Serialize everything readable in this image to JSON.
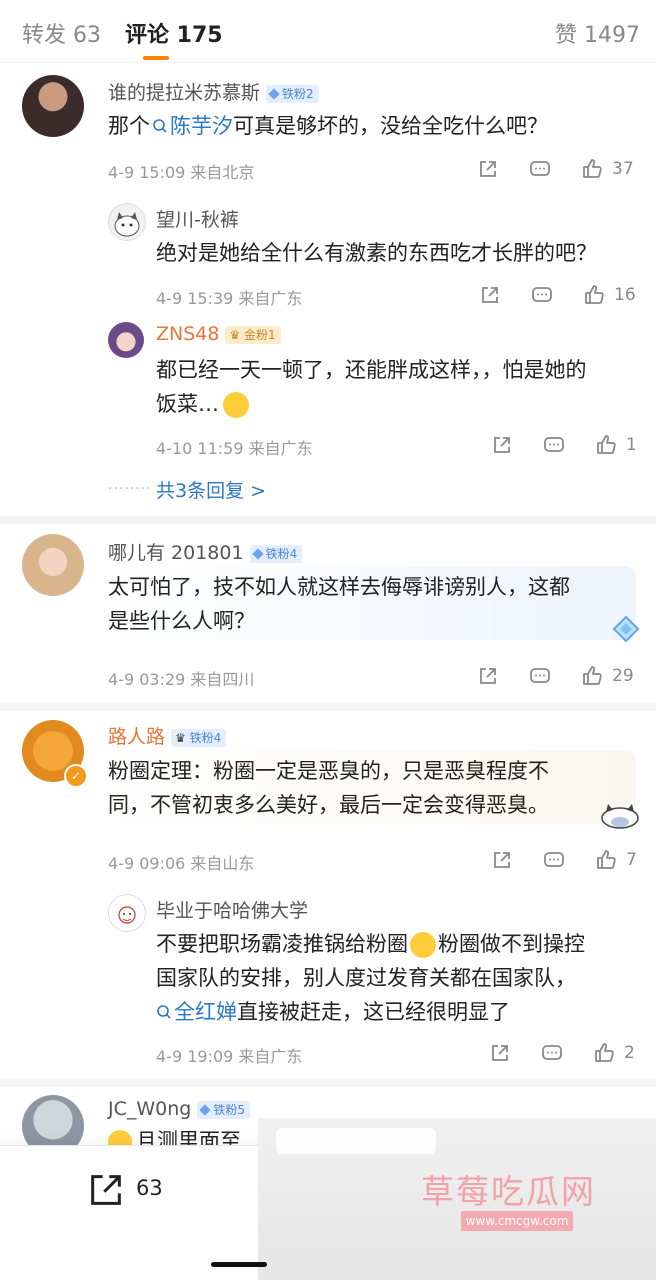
{
  "tabs": {
    "repost": "转发 63",
    "comment": "评论 175",
    "like": "赞 1497"
  },
  "comments": [
    {
      "user": "谁的提拉米苏慕斯",
      "badge": "铁粉2",
      "text_pre": "那个",
      "mention": "陈芋汐",
      "text_post": "可真是够坏的，没给全吃什么吧？",
      "meta": "4-9 15:09  来自北京",
      "likes": "37",
      "replies": [
        {
          "user": "望川-秋裤",
          "text": "绝对是她给全什么有激素的东西吃才长胖的吧？",
          "meta": "4-9 15:39  来自广东",
          "likes": "16"
        },
        {
          "user": "ZNS48",
          "badge": "金粉1",
          "text_line1": "都已经一天一顿了，还能胖成这样，，怕是她的",
          "text_line2": "饭菜…",
          "meta": "4-10 11:59  来自广东",
          "likes": "1"
        }
      ],
      "more": "共3条回复 >"
    },
    {
      "user": "哪儿有 201801",
      "badge": "铁粉4",
      "text_line1": "太可怕了，技不如人就这样去侮辱诽谤别人，这都",
      "text_line2": "是些什么人啊？",
      "meta": "4-9 03:29  来自四川",
      "likes": "29"
    },
    {
      "user": "路人路",
      "badge": "铁粉4",
      "text_line1": "粉圈定理：粉圈一定是恶臭的，只是恶臭程度不",
      "text_line2": "同，不管初衷多么美好，最后一定会变得恶臭。",
      "meta": "4-9 09:06  来自山东",
      "likes": "7",
      "replies": [
        {
          "user": "毕业于哈哈佛大学",
          "text_line1": "不要把职场霸凌推锅给粉圈",
          "text_line1b": "粉圈做不到操控",
          "text_line2": "国家队的安排，别人度过发育关都在国家队，",
          "mention": "全红婵",
          "text_line3": "直接被赶走，这已经很明显了",
          "meta": "4-9 19:09  来自广东",
          "likes": "2"
        }
      ]
    },
    {
      "user": "JC_W0ng",
      "badge": "铁粉5",
      "text": "且测里面至"
    }
  ],
  "bottom": {
    "repost_count": "63"
  },
  "watermark": {
    "title": "草莓吃瓜网",
    "url": "www.cmcgw.com"
  },
  "colors": {
    "accent": "#ff8200",
    "link": "#2b78c4",
    "badge": "#4b86d8"
  }
}
